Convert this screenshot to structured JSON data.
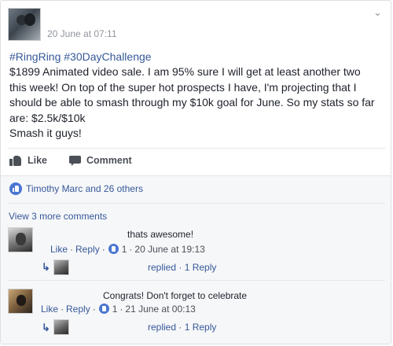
{
  "post": {
    "timestamp": "20 June at 07:11",
    "hashtags": "#RingRing #30DayChallenge",
    "body_lines": [
      "$1899 Animated video sale. I am 95% sure I will get at least another two",
      "this week! On top of the super hot prospects I have, I'm projecting that I",
      "should be able to smash through my $10k goal for June. So my stats so far",
      "are: $2.5k/$10k",
      "Smash it guys!"
    ]
  },
  "actions": {
    "like_label": "Like",
    "comment_label": "Comment"
  },
  "reactions": {
    "summary": "Timothy Marc and 26 others"
  },
  "comments": {
    "view_more": "View 3 more comments",
    "items": [
      {
        "text": "thats awesome!",
        "like_label": "Like",
        "reply_label": "Reply",
        "like_count": "1",
        "timestamp": "20 June at 19:13",
        "replies_label": "replied · 1 Reply"
      },
      {
        "text": "Congrats! Don't forget to celebrate",
        "like_label": "Like",
        "reply_label": "Reply",
        "like_count": "1",
        "timestamp": "21 June at 00:13",
        "replies_label": "replied · 1 Reply"
      }
    ]
  },
  "icons": {
    "options": "chevron-down-icon",
    "like": "thumbs-up-icon",
    "comment": "comment-bubble-icon",
    "reaction": "like-badge-icon",
    "reply": "reply-arrow-icon"
  },
  "colors": {
    "link": "#365899",
    "text": "#1d2129",
    "secondary": "#90949c",
    "like_badge": "#4a76d2",
    "comment_area": "#f6f7f9"
  }
}
